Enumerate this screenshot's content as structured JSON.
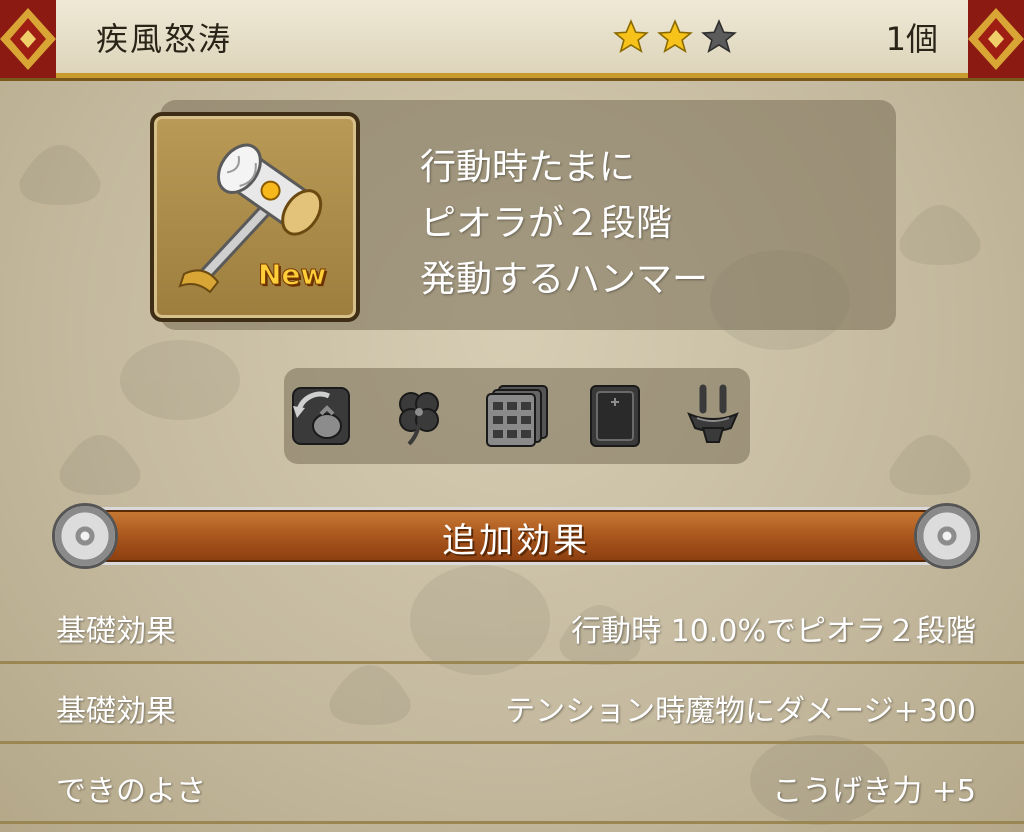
{
  "header": {
    "title": "疾風怒涛",
    "rarity_filled": 2,
    "rarity_max": 3,
    "count": "1個"
  },
  "item": {
    "icon": "hammer-icon",
    "new_badge": "New",
    "description": [
      "行動時たまに",
      "ピオラが２段階",
      "発動するハンマー"
    ]
  },
  "attributes": [
    {
      "icon": "bag-cycle-icon"
    },
    {
      "icon": "clover-icon"
    },
    {
      "icon": "cabinet-stack-icon"
    },
    {
      "icon": "book-icon"
    },
    {
      "icon": "anvil-icon"
    }
  ],
  "section": {
    "label": "追加効果"
  },
  "stats": [
    {
      "key": "基礎効果",
      "value": "行動時 10.0%でピオラ２段階"
    },
    {
      "key": "基礎効果",
      "value": "テンション時魔物にダメージ+300"
    },
    {
      "key": "できのよさ",
      "value": "こうげき力 +5"
    }
  ],
  "colors": {
    "star_filled": "#f7c21a",
    "star_empty": "#5b5b5b",
    "banner": "#a7541c",
    "accent_gold": "#c99a2e"
  }
}
